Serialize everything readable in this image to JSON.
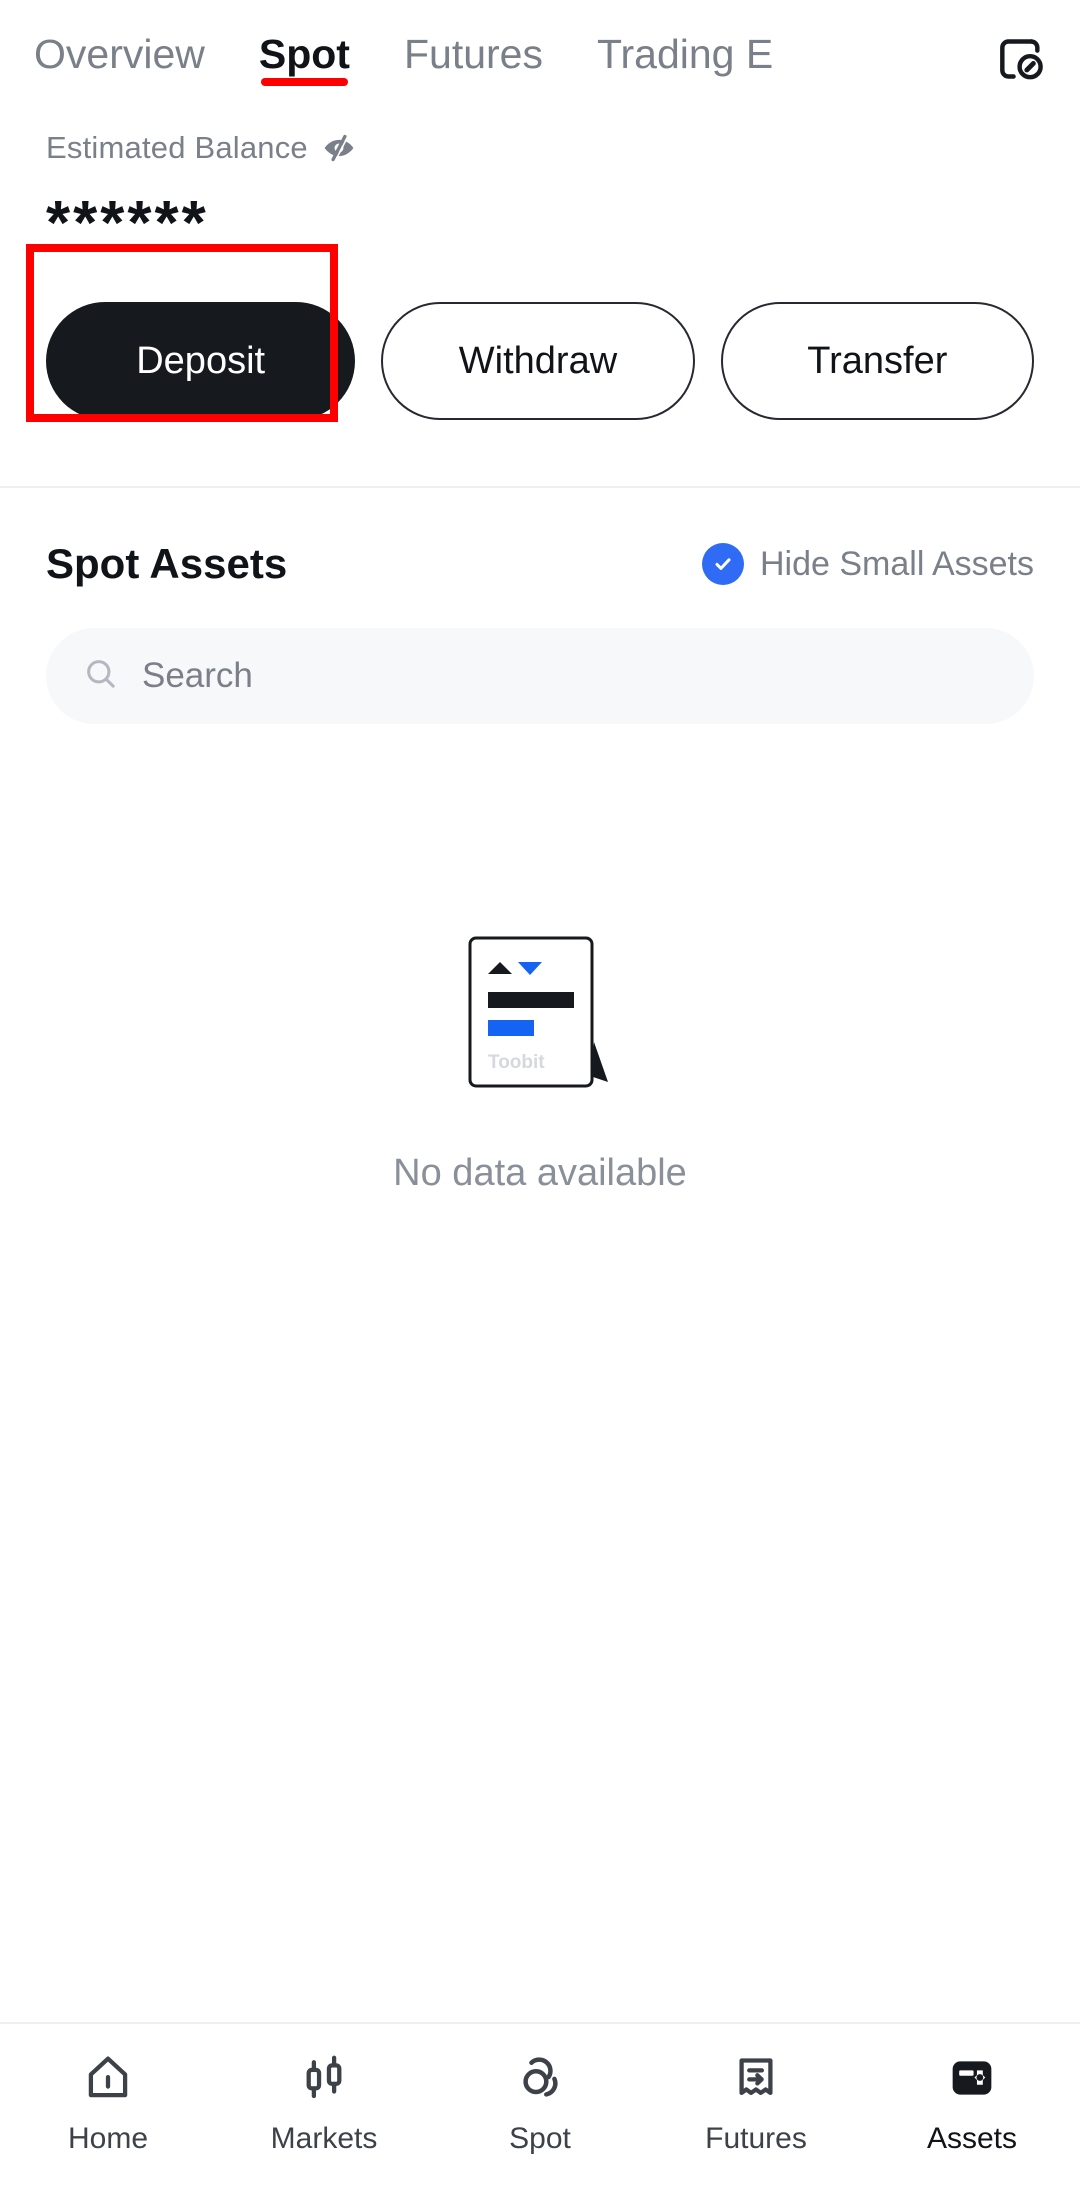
{
  "header": {
    "tabs": [
      {
        "label": "Overview",
        "active": false
      },
      {
        "label": "Spot",
        "active": true
      },
      {
        "label": "Futures",
        "active": false
      },
      {
        "label": "Trading E",
        "active": false
      }
    ],
    "record_icon": "order-record-icon",
    "active_tab_underline_color": "#FF0000"
  },
  "balance": {
    "label": "Estimated Balance",
    "visibility_icon": "eye-off-icon",
    "value": "******"
  },
  "actions": {
    "deposit_label": "Deposit",
    "withdraw_label": "Withdraw",
    "transfer_label": "Transfer",
    "annotation_color": "#FF0000"
  },
  "spot_assets": {
    "title": "Spot Assets",
    "hide_small_label": "Hide Small Assets",
    "hide_small_checked": true,
    "checkbox_color": "#2F6BF5"
  },
  "search": {
    "placeholder": "Search",
    "value": "",
    "icon": "search-icon"
  },
  "empty_state": {
    "message": "No data available",
    "illustration_brand": "Toobit",
    "illustration_accent": "#1463F3"
  },
  "bottom_nav": [
    {
      "label": "Home",
      "icon": "home-icon",
      "active": false
    },
    {
      "label": "Markets",
      "icon": "candlestick-icon",
      "active": false
    },
    {
      "label": "Spot",
      "icon": "swap-icon",
      "active": false
    },
    {
      "label": "Futures",
      "icon": "receipt-arrow-icon",
      "active": false
    },
    {
      "label": "Assets",
      "icon": "vault-icon",
      "active": true
    }
  ]
}
